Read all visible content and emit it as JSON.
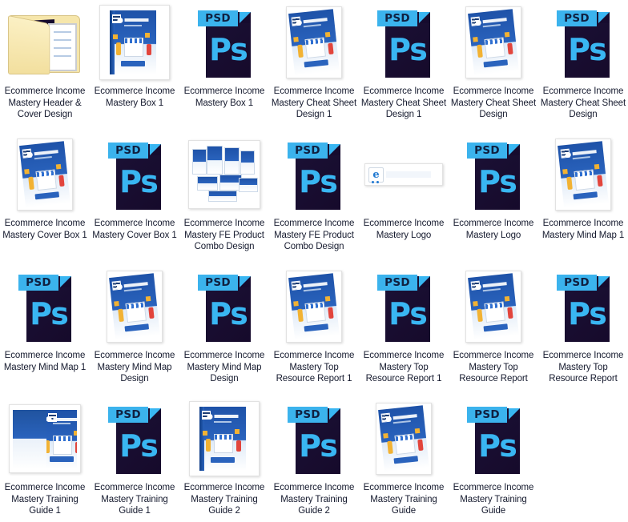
{
  "view": {
    "type": "file-explorer-icon-grid",
    "columns": 7,
    "rows": 4,
    "background_color": "#ffffff",
    "label_color": "#151a2e"
  },
  "colors": {
    "psd_banner": "#3bb3ed",
    "psd_body": "#160b2e",
    "psd_letters": "#39b6f2",
    "folder": "#f6e6ab",
    "cover_blue": "#2a63bd"
  },
  "icons": {
    "folder": "folder-icon",
    "psd": "psd-file-icon",
    "thumbnail": "image-thumbnail",
    "logo": "logo-thumbnail"
  },
  "psd": {
    "banner_text": "PSD",
    "glyph": "Ps"
  },
  "files": [
    {
      "name": "Ecommerce Income Mastery Header & Cover Design",
      "icon": "folder"
    },
    {
      "name": "Ecommerce Income Mastery Box 1",
      "icon": "thumb-box"
    },
    {
      "name": "Ecommerce Income Mastery Box 1",
      "icon": "psd"
    },
    {
      "name": "Ecommerce Income Mastery Cheat Sheet Design 1",
      "icon": "thumb-portrait"
    },
    {
      "name": "Ecommerce Income Mastery Cheat Sheet Design 1",
      "icon": "psd"
    },
    {
      "name": "Ecommerce Income Mastery Cheat Sheet Design",
      "icon": "thumb-portrait"
    },
    {
      "name": "Ecommerce Income Mastery Cheat Sheet Design",
      "icon": "psd"
    },
    {
      "name": "Ecommerce Income Mastery Cover Box 1",
      "icon": "thumb-portrait"
    },
    {
      "name": "Ecommerce Income Mastery Cover Box 1",
      "icon": "psd"
    },
    {
      "name": "Ecommerce Income Mastery FE Product Combo Design",
      "icon": "thumb-combo"
    },
    {
      "name": "Ecommerce Income Mastery FE Product Combo Design",
      "icon": "psd"
    },
    {
      "name": "Ecommerce Income Mastery Logo",
      "icon": "thumb-logo"
    },
    {
      "name": "Ecommerce Income Mastery Logo",
      "icon": "psd"
    },
    {
      "name": "Ecommerce Income Mastery Mind Map 1",
      "icon": "thumb-portrait"
    },
    {
      "name": "Ecommerce Income Mastery Mind Map 1",
      "icon": "psd"
    },
    {
      "name": "Ecommerce Income Mastery Mind Map Design",
      "icon": "thumb-portrait"
    },
    {
      "name": "Ecommerce Income Mastery Mind Map Design",
      "icon": "psd"
    },
    {
      "name": "Ecommerce Income Mastery Top Resource Report 1",
      "icon": "thumb-portrait"
    },
    {
      "name": "Ecommerce Income Mastery Top Resource Report 1",
      "icon": "psd"
    },
    {
      "name": "Ecommerce Income Mastery Top Resource Report",
      "icon": "thumb-portrait"
    },
    {
      "name": "Ecommerce Income Mastery Top Resource Report",
      "icon": "psd"
    },
    {
      "name": "Ecommerce Income Mastery Training Guide 1",
      "icon": "thumb-stack"
    },
    {
      "name": "Ecommerce Income Mastery Training Guide 1",
      "icon": "psd"
    },
    {
      "name": "Ecommerce Income Mastery Training Guide 2",
      "icon": "thumb-box"
    },
    {
      "name": "Ecommerce Income Mastery Training Guide 2",
      "icon": "psd"
    },
    {
      "name": "Ecommerce Income Mastery Training Guide",
      "icon": "thumb-portrait"
    },
    {
      "name": "Ecommerce Income Mastery Training Guide",
      "icon": "psd"
    }
  ]
}
